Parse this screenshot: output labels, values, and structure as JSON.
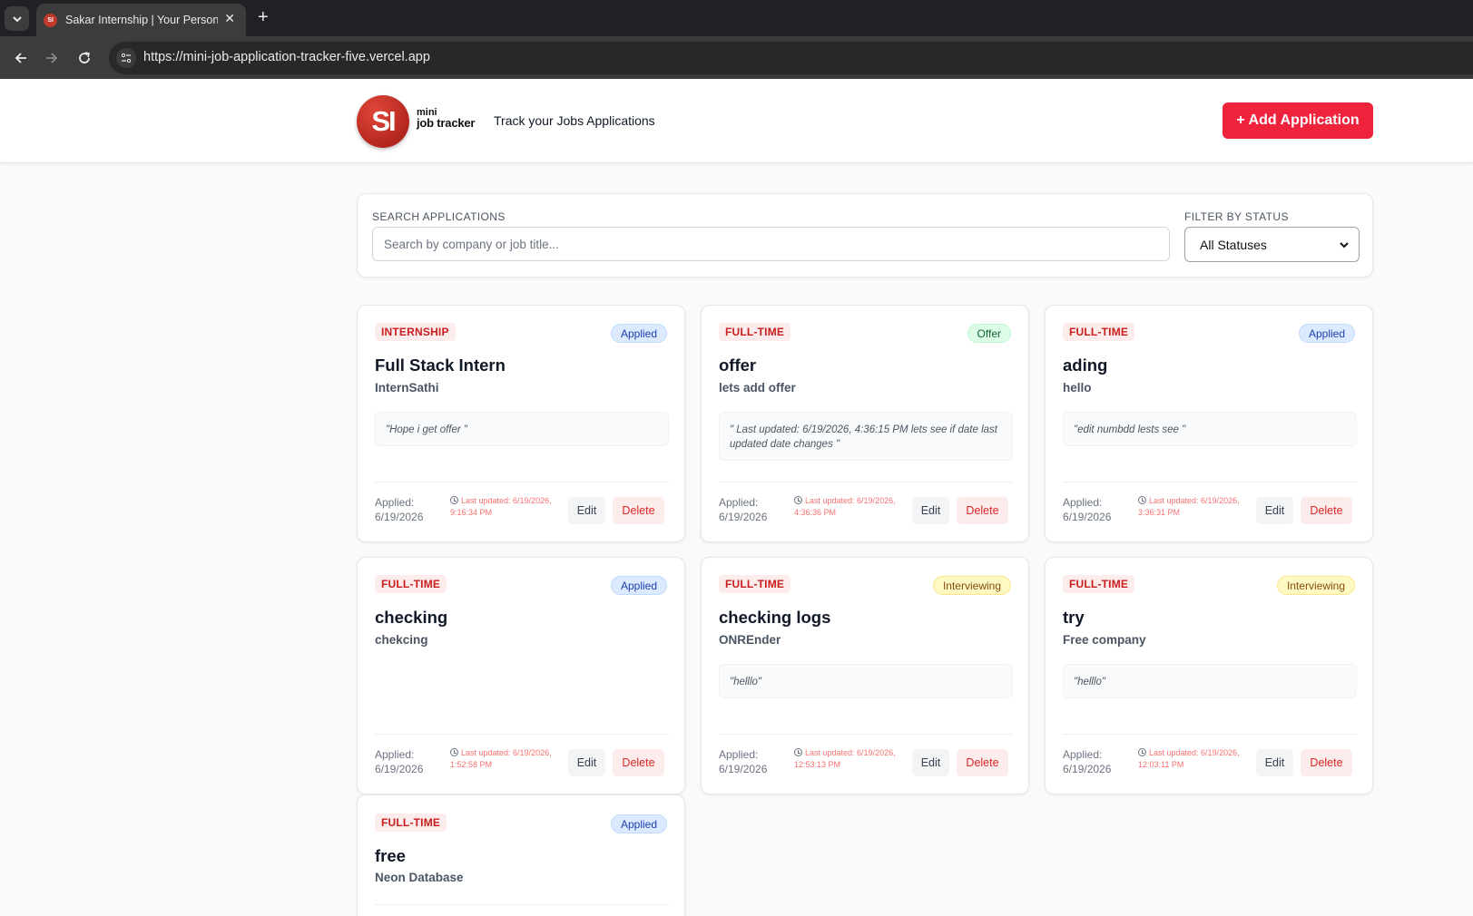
{
  "browser": {
    "tab_title": "Sakar Internship | Your Personal",
    "favicon_text": "SI",
    "url": "https://mini-job-application-tracker-five.vercel.app"
  },
  "header": {
    "logo_text": "SI",
    "brand_line1": "mini",
    "brand_line2": "job tracker",
    "tagline": "Track your Jobs Applications",
    "add_button": "+ Add Application"
  },
  "filters": {
    "search_label": "SEARCH APPLICATIONS",
    "search_placeholder": "Search by company or job title...",
    "status_label": "FILTER BY STATUS",
    "status_value": "All Statuses"
  },
  "labels": {
    "applied_prefix": "Applied:",
    "edit": "Edit",
    "delete": "Delete"
  },
  "cards": [
    {
      "type": "INTERNSHIP",
      "status": "Applied",
      "title": "Full Stack Intern",
      "company": "InternSathi",
      "note": "\"Hope i get offer \"",
      "applied": "6/19/2026",
      "updated": "Last updated: 6/19/2026, 9:16:34 PM"
    },
    {
      "type": "FULL-TIME",
      "status": "Offer",
      "title": "offer",
      "company": "lets add offer",
      "note": "\" Last updated: 6/19/2026, 4:36:15 PM lets see if date last updated date changes \"",
      "applied": "6/19/2026",
      "updated": "Last updated: 6/19/2026, 4:36:36 PM"
    },
    {
      "type": "FULL-TIME",
      "status": "Applied",
      "title": "ading",
      "company": "hello",
      "note": "\"edit numbdd lests see \"",
      "applied": "6/19/2026",
      "updated": "Last updated: 6/19/2026, 3:36:31 PM"
    },
    {
      "type": "FULL-TIME",
      "status": "Applied",
      "title": "checking",
      "company": "chekcing",
      "note": "",
      "applied": "6/19/2026",
      "updated": "Last updated: 6/19/2026, 1:52:58 PM"
    },
    {
      "type": "FULL-TIME",
      "status": "Interviewing",
      "title": "checking logs",
      "company": "ONREnder",
      "note": "\"helllo\"",
      "applied": "6/19/2026",
      "updated": "Last updated: 6/19/2026, 12:53:13 PM"
    },
    {
      "type": "FULL-TIME",
      "status": "Interviewing",
      "title": "try",
      "company": "Free company",
      "note": "\"helllo\"",
      "applied": "6/19/2026",
      "updated": "Last updated: 6/19/2026, 12:03:11 PM"
    },
    {
      "type": "FULL-TIME",
      "status": "Applied",
      "title": "free",
      "company": "Neon Database",
      "note": "",
      "applied": "",
      "updated": ""
    }
  ]
}
